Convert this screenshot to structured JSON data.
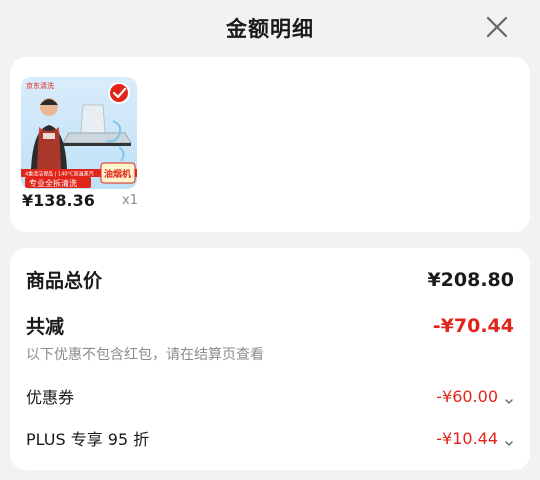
{
  "header": {
    "title": "金额明细"
  },
  "icons": {
    "close": "close-icon",
    "chevron": "chevron-down-icon",
    "check": "check-badge-icon"
  },
  "product": {
    "image": {
      "brand": "京东清洗",
      "tag": "专业全拆清洗",
      "category_badge": "油烟机",
      "strip_text": "4重清洁保品 | 140°C高温蒸汽"
    },
    "price": "¥138.36",
    "quantity": "x1"
  },
  "summary": {
    "total_label": "商品总价",
    "total_value": "¥208.80",
    "discount_label": "共减",
    "discount_value": "-¥70.44",
    "note": "以下优惠不包含红包，请在结算页查看",
    "items": [
      {
        "label": "优惠券",
        "value": "-¥60.00"
      },
      {
        "label": "PLUS 专享 95 折",
        "value": "-¥10.44"
      }
    ]
  },
  "colors": {
    "accent_red": "#e1251b",
    "background": "#f2f2f2",
    "card": "#ffffff"
  }
}
